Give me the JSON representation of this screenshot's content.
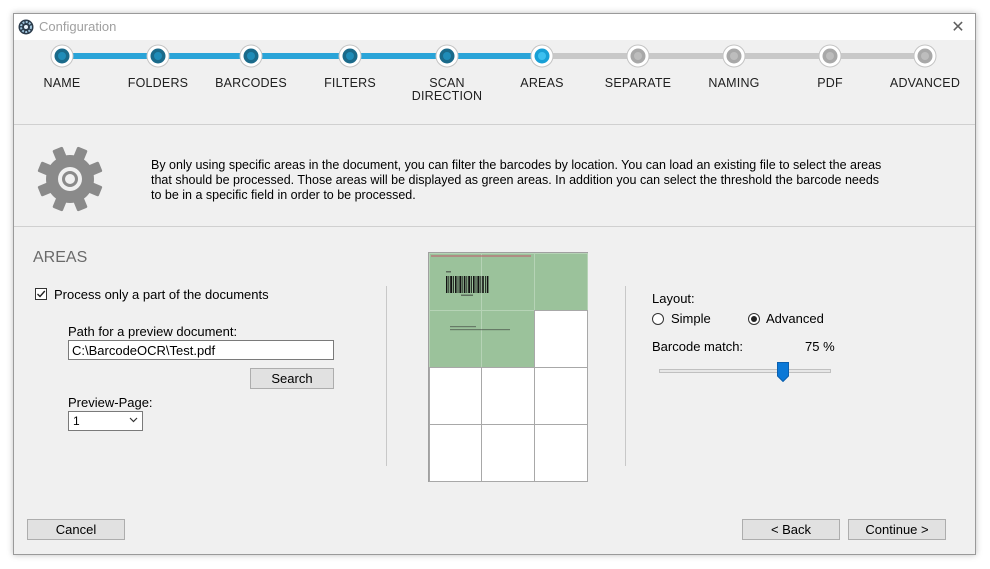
{
  "window": {
    "title": "Configuration",
    "close_glyph": "✕"
  },
  "steps": [
    {
      "label": "NAME",
      "state": "done"
    },
    {
      "label": "FOLDERS",
      "state": "done"
    },
    {
      "label": "BARCODES",
      "state": "done"
    },
    {
      "label": "FILTERS",
      "state": "done"
    },
    {
      "label": "SCAN\nDIRECTION",
      "state": "done"
    },
    {
      "label": "AREAS",
      "state": "current"
    },
    {
      "label": "SEPARATE",
      "state": "todo"
    },
    {
      "label": "NAMING",
      "state": "todo"
    },
    {
      "label": "PDF",
      "state": "todo"
    },
    {
      "label": "ADVANCED",
      "state": "todo"
    }
  ],
  "colors": {
    "step_done": "#1a6a8a",
    "step_current": "#18a0d6",
    "step_todo": "#a8a8a8",
    "line_done": "#2aa4d8",
    "line_todo": "#c8c8c8",
    "area_green": "#9bc29b"
  },
  "info": {
    "icon": "gear-icon",
    "text": "By only using specific areas in the document, you can filter the barcodes by location. You can load an existing file to select the areas that should be processed. Those areas will be displayed as green areas. In addition you can select the threshold the barcode needs to be in a specific field in order to be processed."
  },
  "areas": {
    "title": "AREAS",
    "process_checkbox": {
      "label": "Process only a part of the documents",
      "checked": true
    },
    "path_label": "Path for a preview document:",
    "path_value": "C:\\BarcodeOCR\\Test.pdf",
    "search_button": "Search",
    "preview_page_label": "Preview-Page:",
    "preview_page_value": "1",
    "grid": {
      "rows": 4,
      "cols": 3,
      "selected": [
        [
          true,
          true,
          true
        ],
        [
          true,
          true,
          false
        ],
        [
          false,
          false,
          false
        ],
        [
          false,
          false,
          false
        ]
      ]
    }
  },
  "layout": {
    "label": "Layout:",
    "options": [
      {
        "label": "Simple",
        "selected": false
      },
      {
        "label": "Advanced",
        "selected": true
      }
    ],
    "barcode_match_label": "Barcode match:",
    "barcode_match_value": "75 %",
    "barcode_match_fraction": 0.75
  },
  "footer": {
    "cancel": "Cancel",
    "back": "< Back",
    "continue": "Continue >"
  }
}
